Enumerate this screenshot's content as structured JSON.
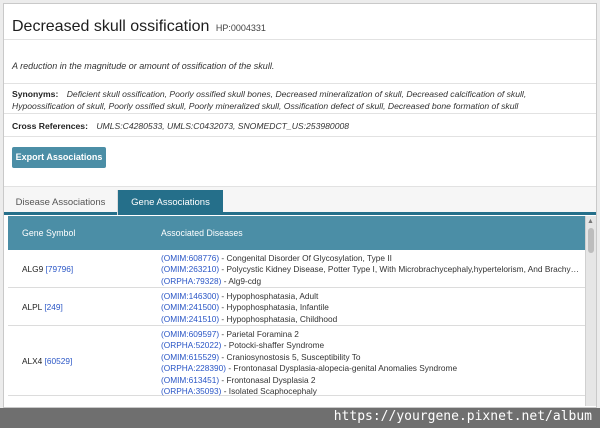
{
  "term": {
    "title": "Decreased skull ossification",
    "id": "HP:0004331",
    "definition": "A reduction in the magnitude or amount of ossification of the skull."
  },
  "synonyms": {
    "label": "Synonyms:",
    "value": "Deficient skull ossification, Poorly ossified skull bones, Decreased mineralization of skull, Decreased calcification of skull, Hypoossification of skull, Poorly ossified skull, Poorly mineralized skull, Ossification defect of skull, Decreased bone formation of skull"
  },
  "cross_references": {
    "label": "Cross References:",
    "value": "UMLS:C4280533, UMLS:C0432073, SNOMEDCT_US:253980008"
  },
  "export_button": "Export Associations",
  "tabs": [
    {
      "label": "Disease Associations",
      "active": false
    },
    {
      "label": "Gene Associations",
      "active": true
    }
  ],
  "table": {
    "headers": [
      "Gene Symbol",
      "Associated Diseases"
    ],
    "rows": [
      {
        "gene": "ALG9",
        "gene_id": "[79796]",
        "diseases": [
          {
            "id": "(OMIM:608776)",
            "name": " - Congenital Disorder Of Glycosylation, Type II"
          },
          {
            "id": "(OMIM:263210)",
            "name": " - Polycystic Kidney Disease, Potter Type I, With Microbrachycephaly,hypertelorism, And Brachyme..."
          },
          {
            "id": "(ORPHA:79328)",
            "name": " - Alg9-cdg"
          }
        ]
      },
      {
        "gene": "ALPL",
        "gene_id": "[249]",
        "diseases": [
          {
            "id": "(OMIM:146300)",
            "name": " - Hypophosphatasia, Adult"
          },
          {
            "id": "(OMIM:241500)",
            "name": " - Hypophosphatasia, Infantile"
          },
          {
            "id": "(OMIM:241510)",
            "name": " - Hypophosphatasia, Childhood"
          }
        ]
      },
      {
        "gene": "ALX4",
        "gene_id": "[60529]",
        "diseases": [
          {
            "id": "(OMIM:609597)",
            "name": " - Parietal Foramina 2"
          },
          {
            "id": "(ORPHA:52022)",
            "name": " - Potocki-shaffer Syndrome"
          },
          {
            "id": "(OMIM:615529)",
            "name": " - Craniosynostosis 5, Susceptibility To"
          },
          {
            "id": "(ORPHA:228390)",
            "name": " - Frontonasal Dysplasia-alopecia-genital Anomalies Syndrome"
          },
          {
            "id": "(OMIM:613451)",
            "name": " - Frontonasal Dysplasia 2"
          },
          {
            "id": "(ORPHA:35093)",
            "name": " - Isolated Scaphocephaly"
          }
        ]
      }
    ]
  },
  "watermark": "https://yourgene.pixnet.net/album",
  "colors": {
    "accent": "#256f8a",
    "header": "#4b8ea6",
    "link": "#2a56c6"
  }
}
